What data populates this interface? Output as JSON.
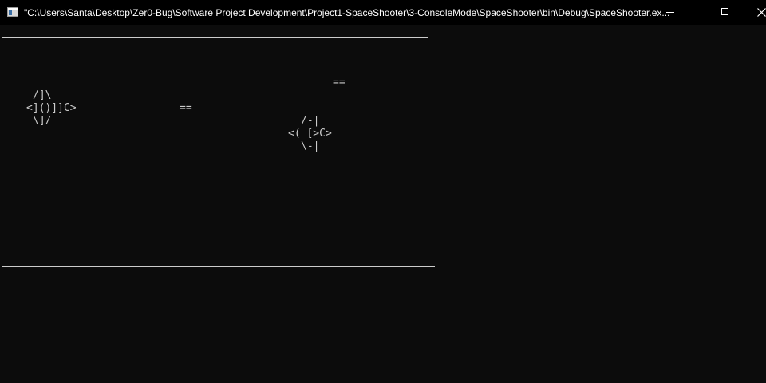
{
  "window": {
    "title": "\"C:\\Users\\Santa\\Desktop\\Zer0-Bug\\Software Project Development\\Project1-SpaceShooter\\3-ConsoleMode\\SpaceShooter\\bin\\Debug\\SpaceShooter.ex..."
  },
  "colors": {
    "background": "#0c0c0c",
    "titlebar": "#000000",
    "text": "#cccccc"
  },
  "icons": {
    "app": "console-app-icon",
    "minimize": "minimize-icon",
    "maximize": "maximize-icon",
    "close": "close-icon"
  },
  "console": {
    "player_ship": [
      "/]\\",
      "<]()]]C>",
      "\\]/"
    ],
    "player_bullet": "==",
    "enemy_ship": [
      "/-|",
      "<( [>C>",
      "\\-|"
    ],
    "enemy_bullet": "=="
  }
}
